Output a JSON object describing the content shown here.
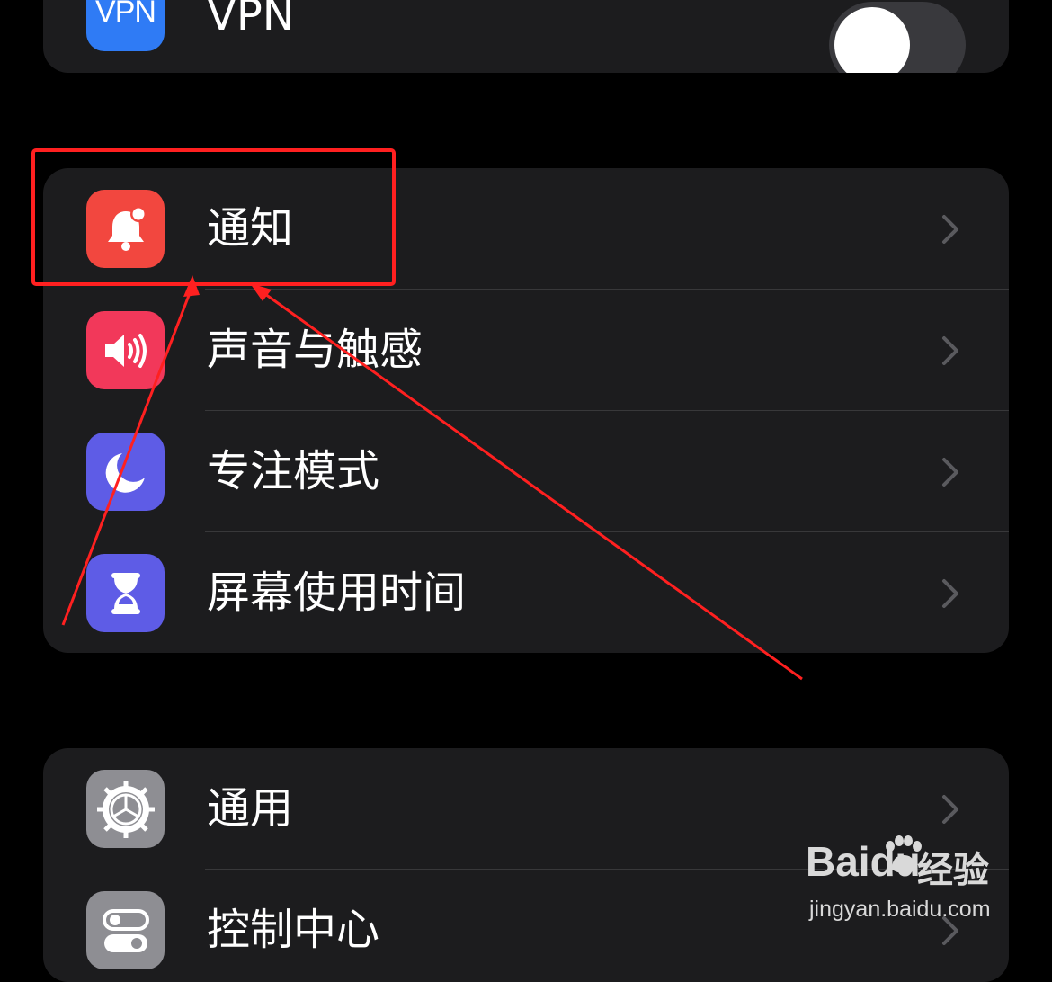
{
  "vpn": {
    "label": "VPN",
    "icon": "vpn-icon",
    "icon_text": "VPN",
    "icon_color": "#2f7bf5",
    "toggle_on": false
  },
  "group_notifications": {
    "items": [
      {
        "label": "通知",
        "icon": "bell-icon",
        "color": "#f2473f"
      },
      {
        "label": "声音与触感",
        "icon": "speaker-icon",
        "color": "#f2385a"
      },
      {
        "label": "专注模式",
        "icon": "moon-icon",
        "color": "#5e5ce6"
      },
      {
        "label": "屏幕使用时间",
        "icon": "hourglass-icon",
        "color": "#5e5ce6"
      }
    ]
  },
  "group_general": {
    "items": [
      {
        "label": "通用",
        "icon": "gear-icon",
        "color": "#8e8e93"
      },
      {
        "label": "控制中心",
        "icon": "toggles-icon",
        "color": "#8e8e93"
      }
    ]
  },
  "annotation": {
    "highlight_color": "#ff2020"
  },
  "watermark": {
    "brand": "Baidu",
    "brand_cn": "经验",
    "url": "jingyan.baidu.com"
  }
}
